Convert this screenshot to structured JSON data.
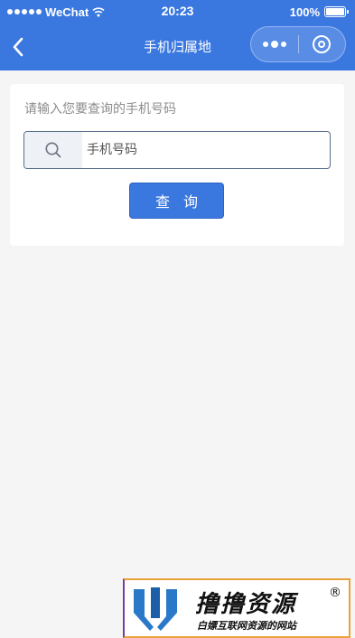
{
  "status_bar": {
    "carrier": "WeChat",
    "time": "20:23",
    "battery": "100%"
  },
  "nav": {
    "title": "手机归属地",
    "icons": {
      "back": "chevron-left-icon",
      "more": "more-dots-icon",
      "close": "target-ring-icon"
    }
  },
  "query_form": {
    "prompt": "请输入您要查询的手机号码",
    "input_placeholder": "手机号码",
    "input_value": "",
    "search_icon": "search-icon",
    "button_label": "查 询"
  },
  "watermark": {
    "title": "撸撸资源",
    "registered": "®",
    "subtitle": "白嫖互联网资源的网站"
  },
  "colors": {
    "accent": "#3a78e0",
    "background": "#f5f5f5",
    "card": "#ffffff",
    "prompt_text": "#8c8c8c"
  }
}
